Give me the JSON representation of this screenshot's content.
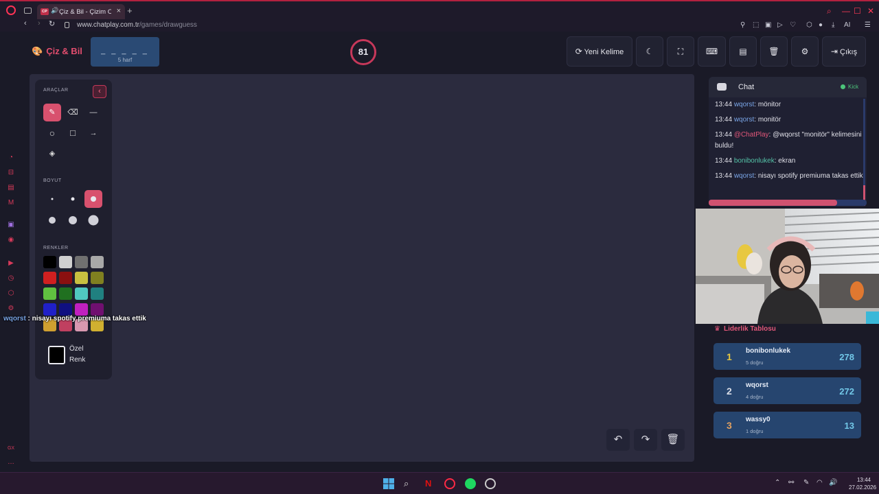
{
  "browser": {
    "tab_title": "Çiz & Bil - Çizim Oy",
    "tab_favicon_text": "CP",
    "url_host": "www.chatplay.com.tr",
    "url_path": "/games/drawguess",
    "ai_label": "AI"
  },
  "app": {
    "title": "Çiz & Bil",
    "word_blanks": "_ _ _ _ _",
    "word_length": "5 harf",
    "timer": "81",
    "buttons": {
      "new_word": "Yeni Kelime",
      "exit": "Çıkış"
    }
  },
  "tools": {
    "section_tools": "ARAÇLAR",
    "section_size": "BOYUT",
    "section_colors": "RENKLER",
    "custom_color_line1": "Özel",
    "custom_color_line2": "Renk",
    "colors": [
      "#000000",
      "#d0d0d0",
      "#707070",
      "#a8a8a8",
      "#d02020",
      "#8a1010",
      "#c8c040",
      "#808020",
      "#60c040",
      "#207020",
      "#50c8c0",
      "#208080",
      "#2020c8",
      "#101080",
      "#c020c0",
      "#701070",
      "#d0a030",
      "#c04060",
      "#d898b0",
      "#d0b030"
    ]
  },
  "overlay_message": {
    "user": "wqorst",
    "text": " : nisayı spotify premiuma takas ettik"
  },
  "chat": {
    "title": "Chat",
    "platform": "Kick",
    "messages": [
      {
        "time": "13:44",
        "user": "wqorst",
        "text": ": mönitor"
      },
      {
        "time": "13:44",
        "user": "wqorst",
        "text": ": monitör"
      },
      {
        "time": "13:44",
        "user": "@ChatPlay",
        "text": ": @wqorst \"monitör\" kelimesini buldu!"
      },
      {
        "time": "13:44",
        "user": "bonibonlukek",
        "text": ": ekran"
      },
      {
        "time": "13:44",
        "user": "wqorst",
        "text": ": nisayı spotify premiuma takas ettik"
      }
    ]
  },
  "leaderboard": {
    "title": "Liderlik Tablosu",
    "rows": [
      {
        "rank": "1",
        "name": "bonibonlukek",
        "correct": "5 doğru",
        "score": "278",
        "rank_color": "#e8c840"
      },
      {
        "rank": "2",
        "name": "wqorst",
        "correct": "4 doğru",
        "score": "272",
        "rank_color": "#d8dce6"
      },
      {
        "rank": "3",
        "name": "wassy0",
        "correct": "1 doğru",
        "score": "13",
        "rank_color": "#e0a060"
      }
    ]
  },
  "taskbar": {
    "time": "13:44",
    "date": "27.02.2026"
  },
  "colors": {
    "accent": "#e3577a",
    "canvas": "#2b2b3e",
    "panel": "#1f1f2e"
  }
}
